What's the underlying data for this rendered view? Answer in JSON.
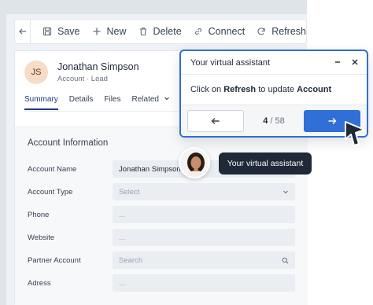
{
  "toolbar": {
    "back_icon": "arrow-left-icon",
    "buttons": [
      {
        "label": "Save",
        "icon": "save-icon"
      },
      {
        "label": "New",
        "icon": "plus-icon"
      },
      {
        "label": "Delete",
        "icon": "trash-icon"
      },
      {
        "label": "Connect",
        "icon": "link-icon"
      },
      {
        "label": "Refresh",
        "icon": "refresh-icon"
      }
    ]
  },
  "record": {
    "initials": "JS",
    "name": "Jonathan Simpson",
    "type": "Account",
    "separator": "·",
    "status": "Lead"
  },
  "tabs": [
    "Summary",
    "Details",
    "Files",
    "Related"
  ],
  "section": {
    "title": "Account Information",
    "fields": [
      {
        "label": "Account Name",
        "value": "Jonathan Simpson"
      },
      {
        "label": "Account Type",
        "value": "Select"
      },
      {
        "label": "Phone",
        "value": "..."
      },
      {
        "label": "Website",
        "value": "..."
      },
      {
        "label": "Partner Account",
        "value": "Search"
      },
      {
        "label": "Adress",
        "value": "..."
      }
    ]
  },
  "assistant": {
    "popup_title": "Your virtual assistant",
    "body_prefix": "Click on",
    "body_action": "Refresh",
    "body_mid": "to update",
    "body_target": "Account",
    "current_step": "4",
    "total_steps": "58",
    "count_separator": "/",
    "bubble_text": "Your virtual assistant"
  },
  "colors": {
    "accent": "#2f6fd6",
    "tab_active": "#1e3a8a",
    "bubble_bg": "#1f2937"
  }
}
